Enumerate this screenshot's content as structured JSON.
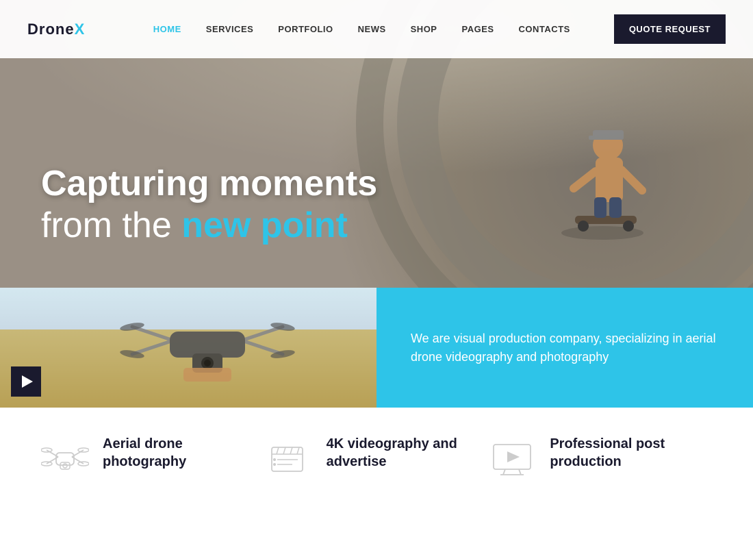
{
  "brand": {
    "name_prefix": "Drone",
    "name_suffix": "X"
  },
  "nav": {
    "links": [
      {
        "label": "HOME",
        "active": true
      },
      {
        "label": "SERVICES",
        "active": false
      },
      {
        "label": "PORTFOLIO",
        "active": false
      },
      {
        "label": "NEWS",
        "active": false
      },
      {
        "label": "SHOP",
        "active": false
      },
      {
        "label": "PAGES",
        "active": false
      },
      {
        "label": "CONTACTS",
        "active": false
      }
    ],
    "quote_btn": "QUOTE REQUEST"
  },
  "hero": {
    "line1": "Capturing moments",
    "line2_plain": "from the ",
    "line2_accent": "new point"
  },
  "promo": {
    "description": "We are visual production company, specializing in aerial drone videography and photography"
  },
  "features": [
    {
      "title_line1": "Aerial drone",
      "title_line2": "photography"
    },
    {
      "title_line1": "4K videography and",
      "title_line2": "advertise"
    },
    {
      "title_line1": "Professional post",
      "title_line2": "production"
    }
  ],
  "colors": {
    "accent": "#2ec4e8",
    "dark": "#1a1a2e",
    "white": "#ffffff"
  }
}
